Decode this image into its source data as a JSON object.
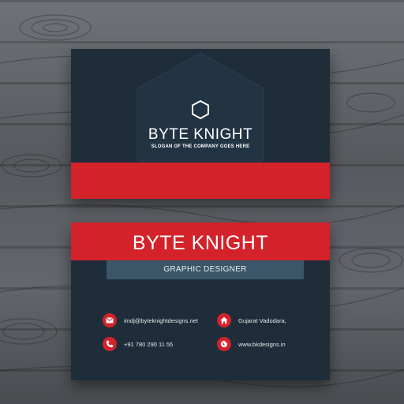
{
  "front": {
    "company": "BYTE KNIGHT",
    "slogan": "SLOGAN OF THE COMPANY GOES HERE"
  },
  "back": {
    "name": "BYTE KNIGHT",
    "role": "GRAPHIC DESIGNER",
    "contacts": {
      "email": "imdj@byteknightdesigns.net",
      "phone": "+91 780 290 11 55",
      "address": "Gujarat Vadodara,",
      "website": "www.bkdesigns.in"
    }
  },
  "colors": {
    "card": "#1f2d3a",
    "accent_red": "#d3222a",
    "role_bar": "#3a5668",
    "wood": "#5d5f64"
  },
  "icons": {
    "logo": "hexagon-outline-icon",
    "email": "envelope-icon",
    "phone": "phone-icon",
    "address": "home-icon",
    "website": "globe-icon"
  }
}
